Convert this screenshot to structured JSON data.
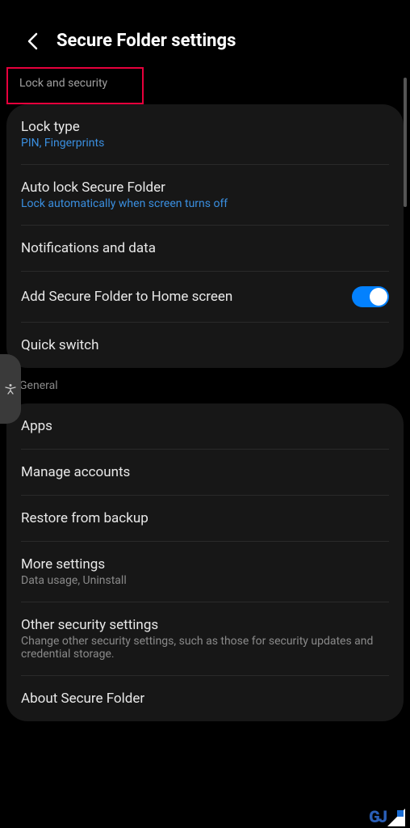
{
  "header": {
    "title": "Secure Folder settings"
  },
  "sections": {
    "lock_security": {
      "header": "Lock and security",
      "items": {
        "lock_type": {
          "title": "Lock type",
          "subtitle": "PIN, Fingerprints"
        },
        "auto_lock": {
          "title": "Auto lock Secure Folder",
          "subtitle": "Lock automatically when screen turns off"
        },
        "notifications": {
          "title": "Notifications and data"
        },
        "add_home": {
          "title": "Add Secure Folder to Home screen",
          "toggle": true
        },
        "quick_switch": {
          "title": "Quick switch"
        }
      }
    },
    "general": {
      "header": "General",
      "items": {
        "apps": {
          "title": "Apps"
        },
        "manage_accounts": {
          "title": "Manage accounts"
        },
        "restore": {
          "title": "Restore from backup"
        },
        "more_settings": {
          "title": "More settings",
          "subtitle": "Data usage, Uninstall"
        },
        "other_security": {
          "title": "Other security settings",
          "subtitle": "Change other security settings, such as those for security updates and credential storage."
        },
        "about": {
          "title": "About Secure Folder"
        }
      }
    }
  },
  "watermark": {
    "text": "GJ"
  }
}
